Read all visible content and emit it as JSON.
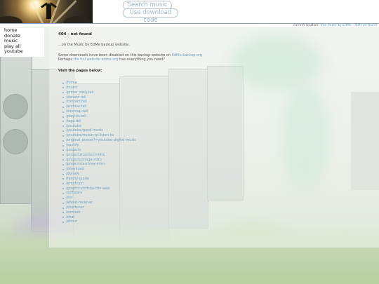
{
  "header": {
    "search_label": "Search music",
    "download_label": "Use download code"
  },
  "location": {
    "prefix": "current location:",
    "site": "free music by EdMe",
    "separator": " - ",
    "page": "404 not found"
  },
  "sidenav": {
    "items": [
      {
        "label": "home"
      },
      {
        "label": "donate"
      },
      {
        "label": "music"
      },
      {
        "label": "play all"
      },
      {
        "label": "youtube"
      }
    ]
  },
  "content": {
    "title": "404 - not found",
    "subtitle": "...on the Music by EdMe backup website.",
    "line1_text": "Some downloads have been disabled on this backup website on ",
    "line1_link": "EdMe-backup.org",
    "line2_prefix": "Perhaps ",
    "line2_link": "the full website edme.org",
    "line2_suffix": " has everything you need?",
    "visit_label": "Visit the pages below:",
    "pages": [
      "/home",
      "/music",
      "/prime_daily.tell",
      "/donate.tell",
      "/contact.tell",
      "/archive.tell",
      "/sitemap.tell",
      "/playlist.tell",
      "/lego.tell",
      "/youtube",
      "/youtube/good-music",
      "/youtube/music-to-listen-to",
      "/original_preset?=youtube-digital-music",
      "/spotify",
      "/projects",
      "/projects/content-intro",
      "/projects/mega-intro",
      "/projects/archive-intro",
      "/download",
      "/donate",
      "/family-guide",
      "/emoticon",
      "/graphics/offsite-the-web",
      "/software",
      "/css",
      "/about-receiver",
      "/shortener",
      "/contact",
      "/chat",
      "/about"
    ]
  }
}
